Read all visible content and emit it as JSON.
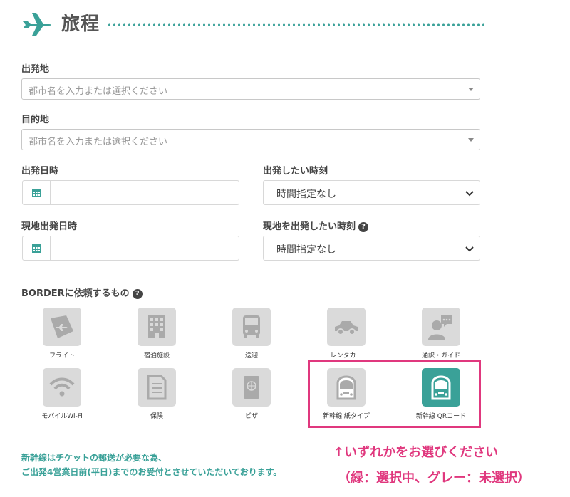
{
  "header": {
    "title": "旅程"
  },
  "departure": {
    "label": "出発地",
    "placeholder": "都市名を入力または選択ください"
  },
  "destination": {
    "label": "目的地",
    "placeholder": "都市名を入力または選択ください"
  },
  "departure_date": {
    "label": "出発日時"
  },
  "departure_time": {
    "label": "出発したい時刻",
    "value": "時間指定なし"
  },
  "local_date": {
    "label": "現地出発日時"
  },
  "local_time": {
    "label": "現地を出発したい時刻",
    "value": "時間指定なし"
  },
  "services": {
    "label": "BORDERに依頼するもの",
    "items": [
      {
        "label": "フライト",
        "icon": "flight-icon",
        "selected": false
      },
      {
        "label": "宿泊施設",
        "icon": "hotel-icon",
        "selected": false
      },
      {
        "label": "送迎",
        "icon": "bus-icon",
        "selected": false
      },
      {
        "label": "レンタカー",
        "icon": "car-icon",
        "selected": false
      },
      {
        "label": "通訳・ガイド",
        "icon": "guide-icon",
        "selected": false
      },
      {
        "label": "モバイルWi-Fi",
        "icon": "wifi-icon",
        "selected": false
      },
      {
        "label": "保険",
        "icon": "document-icon",
        "selected": false
      },
      {
        "label": "ビザ",
        "icon": "passport-icon",
        "selected": false
      },
      {
        "label": "新幹線 紙タイプ",
        "icon": "shinkansen-icon",
        "selected": false
      },
      {
        "label": "新幹線 QRコード",
        "icon": "shinkansen-icon",
        "selected": true
      }
    ]
  },
  "notes": {
    "line1": "新幹線はチケットの郵送が必要な為、",
    "line2": "ご出発4営業日前(平日)までのお受付とさせていただいております。"
  },
  "annotation": {
    "line1": "↑いずれかをお選びください",
    "line2": "（緑：選択中、グレー：未選択）"
  },
  "colors": {
    "accent": "#3aa198",
    "inactive": "#dadada",
    "highlight": "#e0387e"
  }
}
